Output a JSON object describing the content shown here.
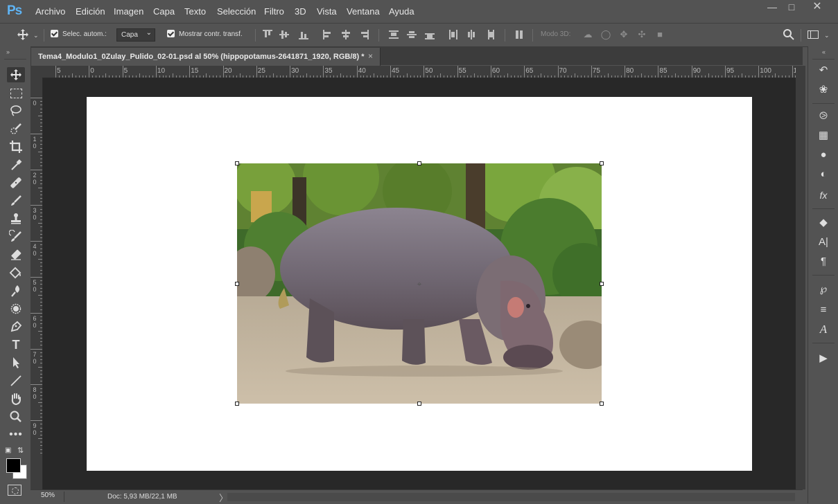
{
  "app": {
    "logo": "Ps",
    "menu": [
      "Archivo",
      "Edición",
      "Imagen",
      "Capa",
      "Texto",
      "Selección",
      "Filtro",
      "3D",
      "Vista",
      "Ventana",
      "Ayuda"
    ],
    "window_controls": [
      "minimize-icon",
      "maximize-icon",
      "close-icon"
    ]
  },
  "options_bar": {
    "auto_select_label": "Selec. autom.:",
    "auto_select_checked": true,
    "auto_select_target": "Capa",
    "show_transform_label": "Mostrar contr. transf.",
    "show_transform_checked": true,
    "mode3d_label": "Modo 3D:"
  },
  "document": {
    "tab_title": "Tema4_Modulo1_0Zulay_Pulido_02-01.psd al 50% (hippopotamus-2641871_1920, RGB/8) *",
    "tab_close": "×",
    "zoom": "50%",
    "doc_info": "Doc: 5,93 MB/22,1 MB",
    "status_arrow": "〉"
  },
  "rulers": {
    "horizontal": [
      "5",
      "0",
      "5",
      "10",
      "15",
      "20",
      "25",
      "30",
      "35",
      "40",
      "45",
      "50",
      "55",
      "60",
      "65",
      "70",
      "75",
      "80",
      "85",
      "90",
      "95",
      "100",
      "105"
    ],
    "vertical": [
      {
        "a": "0",
        "b": ""
      },
      {
        "a": "1",
        "b": "0"
      },
      {
        "a": "2",
        "b": "0"
      },
      {
        "a": "3",
        "b": "0"
      },
      {
        "a": "4",
        "b": "0"
      },
      {
        "a": "5",
        "b": "0"
      },
      {
        "a": "6",
        "b": "0"
      },
      {
        "a": "7",
        "b": "0"
      },
      {
        "a": "8",
        "b": "0"
      },
      {
        "a": "9",
        "b": "0"
      }
    ]
  },
  "tools": [
    "move-tool",
    "marquee-tool",
    "lasso-tool",
    "quick-selection-tool",
    "crop-tool",
    "eyedropper-tool",
    "healing-brush-tool",
    "brush-tool",
    "clone-stamp-tool",
    "history-brush-tool",
    "eraser-tool",
    "paint-bucket-tool",
    "blur-tool",
    "dodge-tool",
    "pen-tool",
    "type-tool",
    "path-selection-tool",
    "line-tool",
    "hand-tool",
    "zoom-tool",
    "more-tools"
  ],
  "colors": {
    "foreground": "#000000",
    "background": "#ffffff",
    "ui_dark": "#535353",
    "pasteboard": "#282828",
    "accent_logo": "#5fb4f4"
  },
  "right_panel_icons": [
    "history-icon",
    "swatches-icon",
    "3d-icon",
    "grid-icon",
    "palette-icon",
    "adjustments-icon",
    "fx-icon",
    "layers-icon",
    "character-icon",
    "paragraph-icon",
    "brushes-icon",
    "properties-icon",
    "glyphs-icon",
    "play-icon"
  ]
}
